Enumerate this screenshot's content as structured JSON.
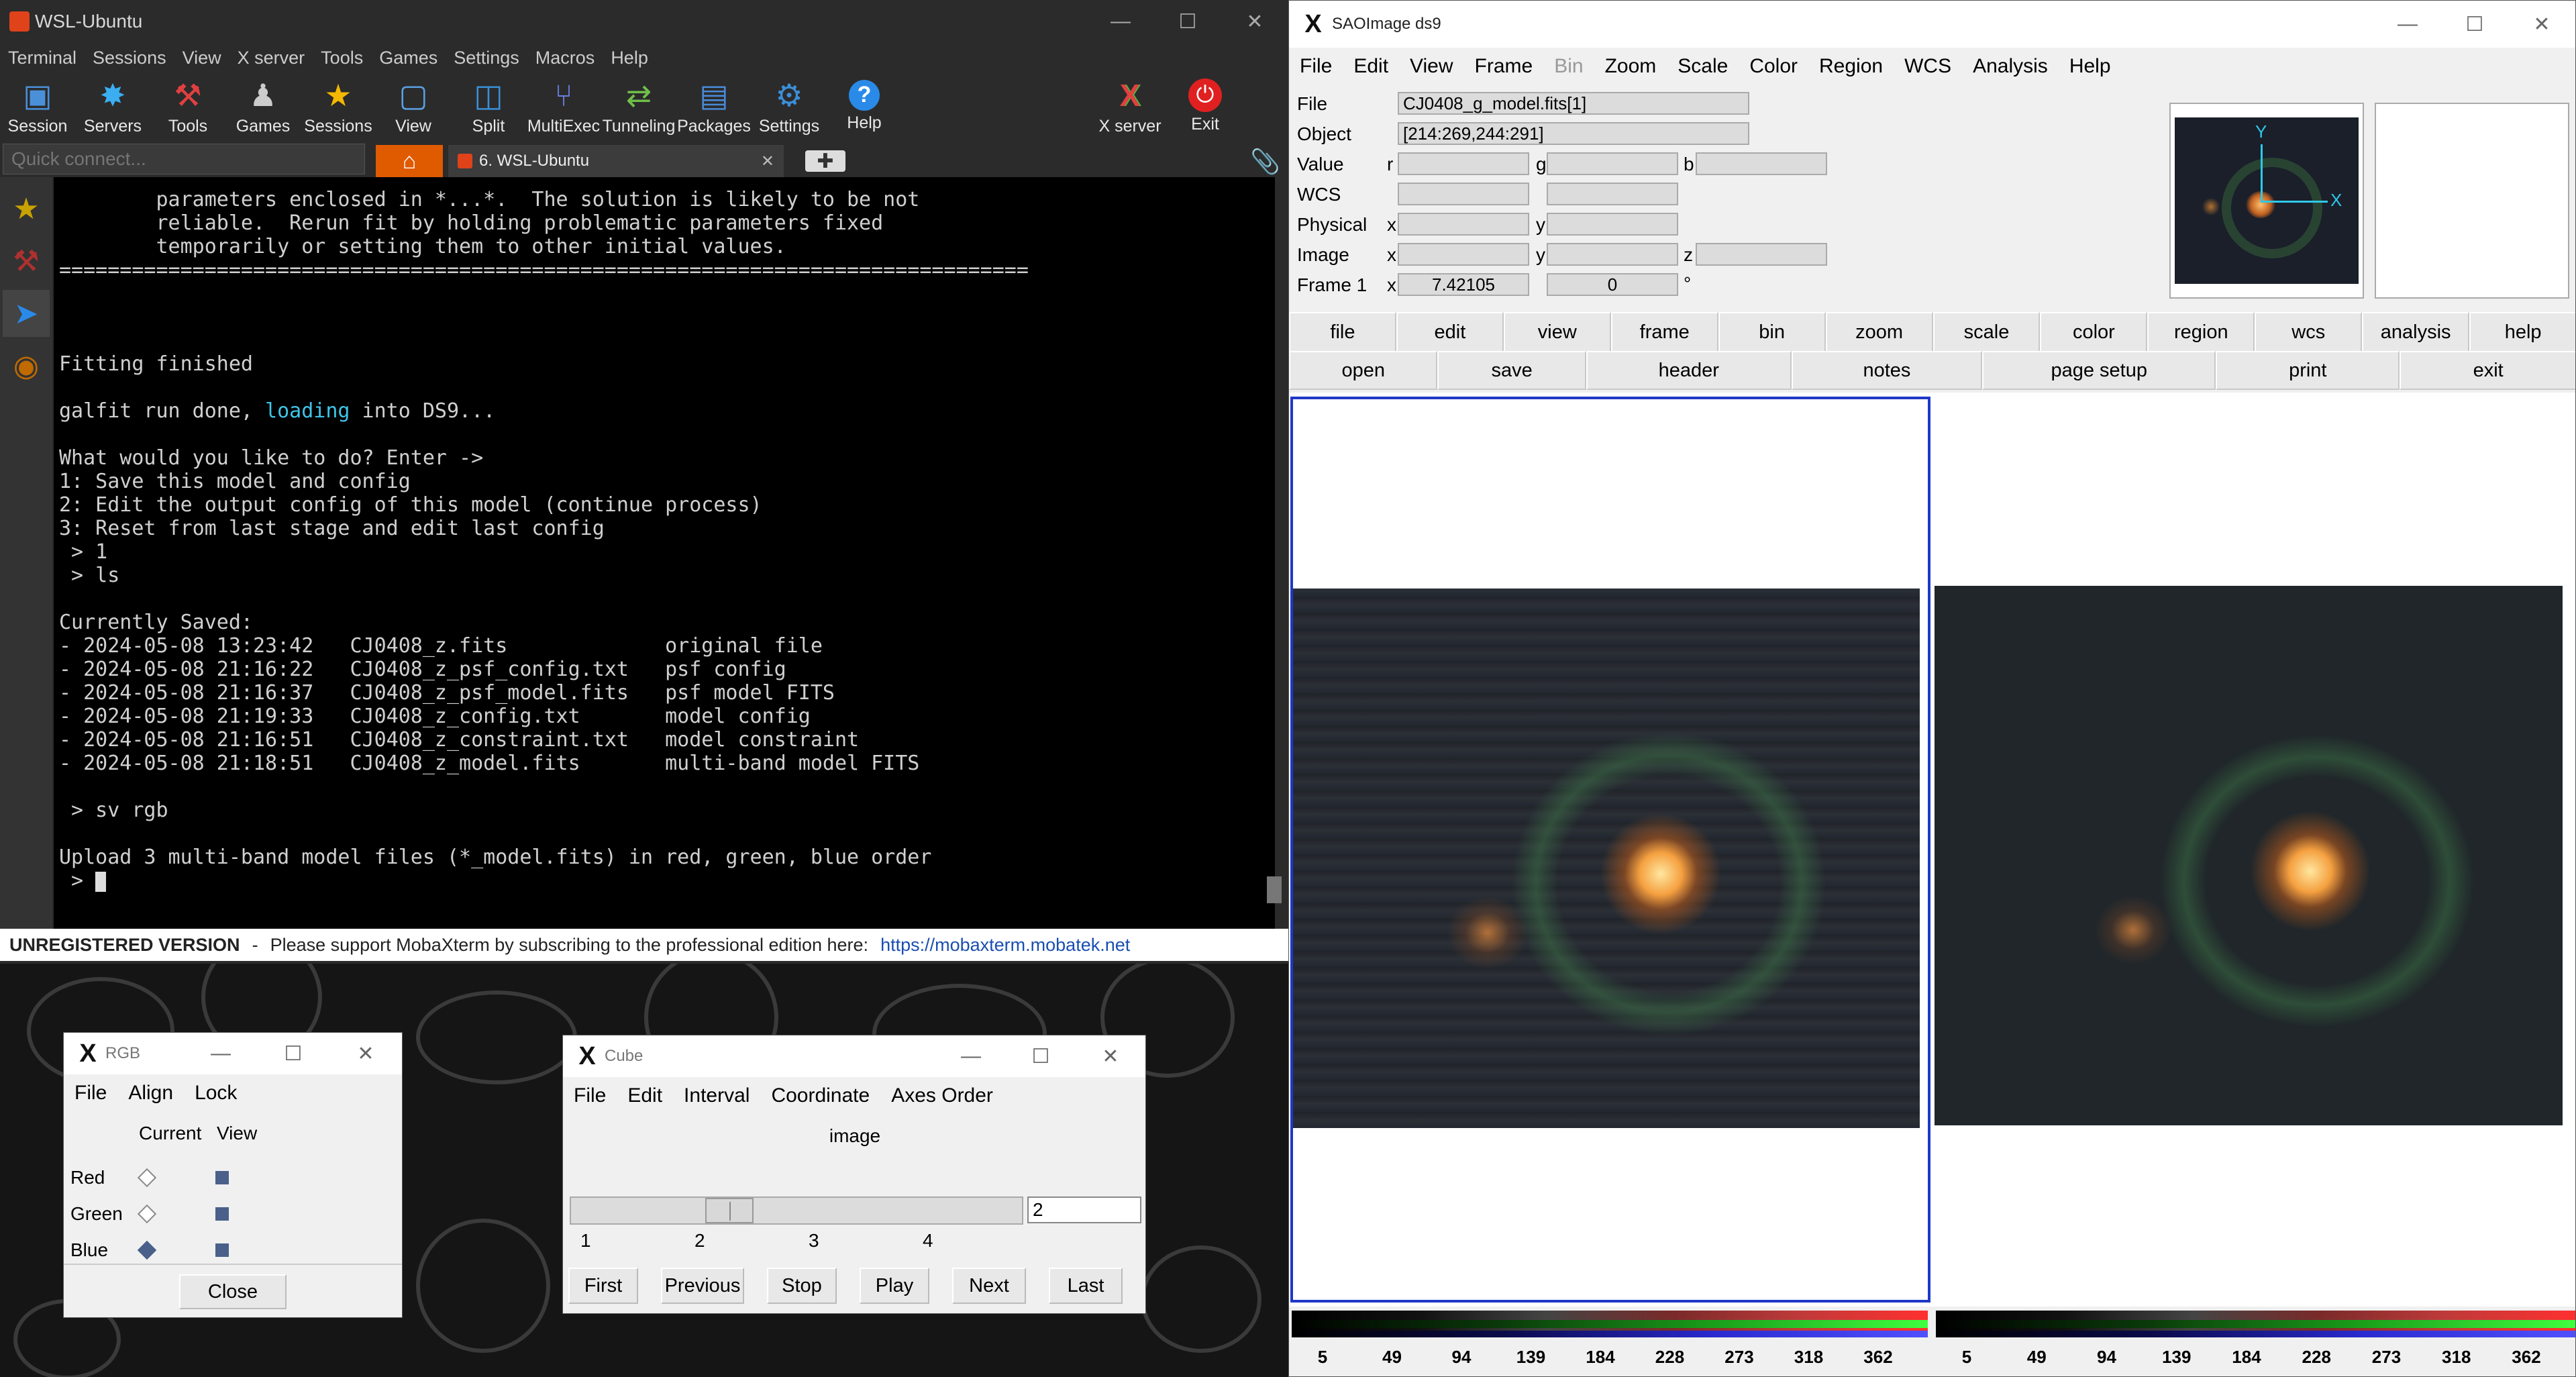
{
  "moba": {
    "title": "WSL-Ubuntu",
    "menu": [
      "Terminal",
      "Sessions",
      "View",
      "X server",
      "Tools",
      "Games",
      "Settings",
      "Macros",
      "Help"
    ],
    "toolbar": [
      {
        "label": "Session",
        "icon": "session-icon",
        "color": "#4a90d9"
      },
      {
        "label": "Servers",
        "icon": "servers-icon",
        "color": "#3aaef0"
      },
      {
        "label": "Tools",
        "icon": "tools-icon",
        "color": "#e04040"
      },
      {
        "label": "Games",
        "icon": "games-icon",
        "color": "#cccccc"
      },
      {
        "label": "Sessions",
        "icon": "star-icon",
        "color": "#f5b800"
      },
      {
        "label": "View",
        "icon": "view-icon",
        "color": "#5aa0e0"
      },
      {
        "label": "Split",
        "icon": "split-icon",
        "color": "#3a8fd8"
      },
      {
        "label": "MultiExec",
        "icon": "multiexec-icon",
        "color": "#6a7fe0"
      },
      {
        "label": "Tunneling",
        "icon": "tunneling-icon",
        "color": "#6fbf4a"
      },
      {
        "label": "Packages",
        "icon": "packages-icon",
        "color": "#4a8ad8"
      },
      {
        "label": "Settings",
        "icon": "settings-gear-icon",
        "color": "#3a8fd8"
      },
      {
        "label": "Help",
        "icon": "help-icon",
        "color": "#2a8ae8"
      }
    ],
    "toolbar_right": [
      {
        "label": "X server",
        "icon": "x-server-icon"
      },
      {
        "label": "Exit",
        "icon": "power-icon"
      }
    ],
    "quick_connect_placeholder": "Quick connect...",
    "tab_label": "6. WSL-Ubuntu",
    "terminal_lines": [
      "        parameters enclosed in *...*.  The solution is likely to be not",
      "        reliable.  Rerun fit by holding problematic parameters fixed",
      "        temporarily or setting them to other initial values.",
      "================================================================================",
      "",
      "",
      "",
      "Fitting finished",
      "",
      "",
      "",
      "What would you like to do? Enter ->",
      "1: Save this model and config",
      "2: Edit the output config of this model (continue process)",
      "3: Reset from last stage and edit last config",
      " > 1",
      " > ls",
      "",
      "Currently Saved:",
      "- 2024-05-08 13:23:42   CJ0408_z.fits             original file",
      "- 2024-05-08 21:16:22   CJ0408_z_psf_config.txt   psf config",
      "- 2024-05-08 21:16:37   CJ0408_z_psf_model.fits   psf model FITS",
      "- 2024-05-08 21:19:33   CJ0408_z_config.txt       model config",
      "- 2024-05-08 21:16:51   CJ0408_z_constraint.txt   model constraint",
      "- 2024-05-08 21:18:51   CJ0408_z_model.fits       multi-band model FITS",
      "",
      " > sv rgb",
      "",
      "Upload 3 multi-band model files (*_model.fits) in red, green, blue order",
      ""
    ],
    "galfit_line_pre": "galfit run done, ",
    "galfit_line_hl": "loading",
    "galfit_line_post": " into DS9...",
    "prompt": " > ",
    "status_bold": "UNREGISTERED VERSION",
    "status_sep": " - ",
    "status_text": "Please support MobaXterm by subscribing to the professional edition here:",
    "status_link": "https://mobaxterm.mobatek.net"
  },
  "ds9": {
    "title": "SAOImage ds9",
    "menu": [
      "File",
      "Edit",
      "View",
      "Frame",
      "Bin",
      "Zoom",
      "Scale",
      "Color",
      "Region",
      "WCS",
      "Analysis",
      "Help"
    ],
    "menu_disabled": "Bin",
    "info": {
      "file_label": "File",
      "file_value": "CJ0408_g_model.fits[1]",
      "object_label": "Object",
      "object_value": "[214:269,244:291]",
      "value_label": "Value",
      "r": "r",
      "g": "g",
      "b": "b",
      "wcs_label": "WCS",
      "physical_label": "Physical",
      "x": "x",
      "y": "y",
      "z": "z",
      "image_label": "Image",
      "frame_label": "Frame 1",
      "frame_x": "7.42105",
      "frame_angle": "0",
      "degree": "°"
    },
    "panner_axes": {
      "x": "X",
      "y": "Y"
    },
    "buttons_row1": [
      "file",
      "edit",
      "view",
      "frame",
      "bin",
      "zoom",
      "scale",
      "color",
      "region",
      "wcs",
      "analysis",
      "help"
    ],
    "buttons_row2": [
      "open",
      "save",
      "header",
      "notes",
      "page setup",
      "print",
      "exit"
    ],
    "colorbar_ticks": [
      "5",
      "49",
      "94",
      "139",
      "184",
      "228",
      "273",
      "318",
      "362"
    ]
  },
  "rgb": {
    "title": "RGB",
    "menu": [
      "File",
      "Align",
      "Lock"
    ],
    "col_current": "Current",
    "col_view": "View",
    "channels": [
      "Red",
      "Green",
      "Blue"
    ],
    "current_channel": "Blue",
    "close_label": "Close"
  },
  "cube": {
    "title": "Cube",
    "menu": [
      "File",
      "Edit",
      "Interval",
      "Coordinate",
      "Axes Order"
    ],
    "axis_label": "image",
    "slice_value": "2",
    "ticks": [
      "1",
      "2",
      "3",
      "4"
    ],
    "buttons": [
      "First",
      "Previous",
      "Stop",
      "Play",
      "Next",
      "Last"
    ]
  }
}
